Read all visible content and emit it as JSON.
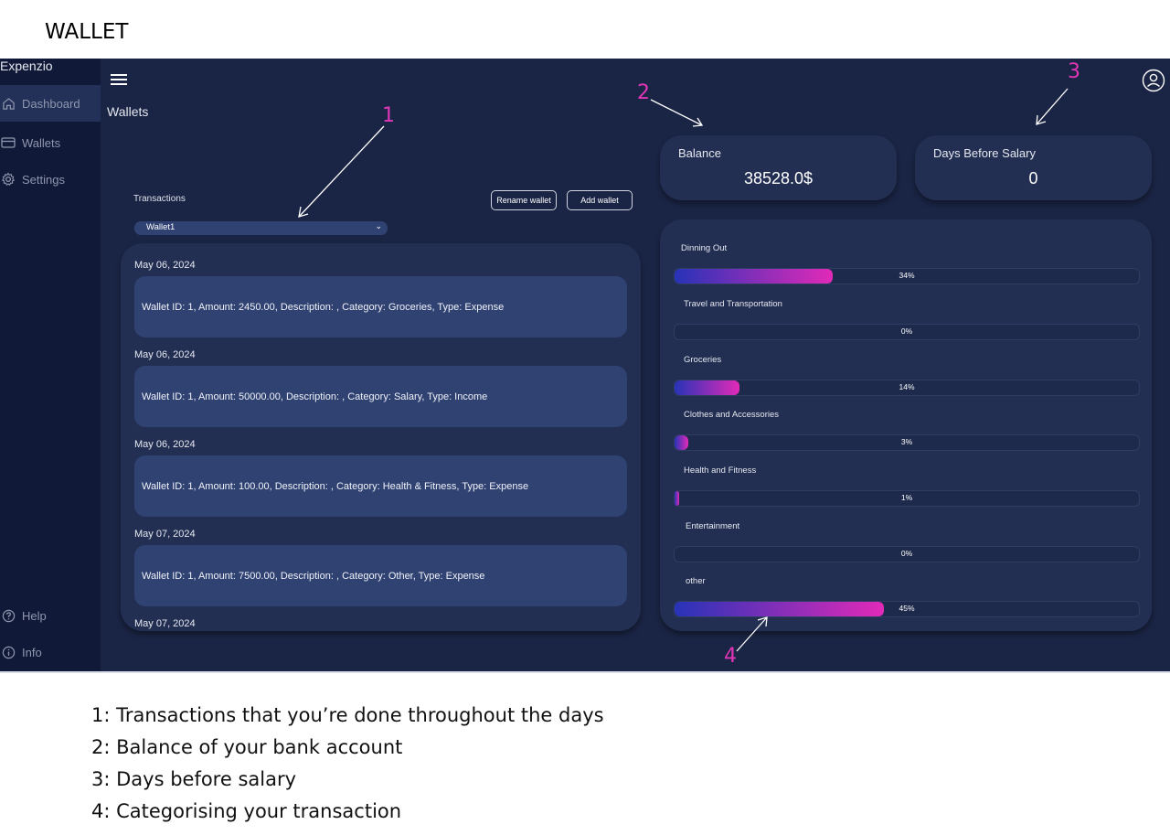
{
  "page": {
    "title": "WALLET"
  },
  "sidebar": {
    "brand": "Expenzio",
    "items": [
      {
        "label": "Dashboard",
        "icon": "home-icon"
      },
      {
        "label": "Wallets",
        "icon": "card-icon"
      },
      {
        "label": "Settings",
        "icon": "gear-icon"
      }
    ],
    "bottom": [
      {
        "label": "Help",
        "icon": "help-icon"
      },
      {
        "label": "Info",
        "icon": "info-icon"
      }
    ]
  },
  "header": {
    "section_title": "Wallets"
  },
  "transactions": {
    "label": "Transactions",
    "rename_label": "Rename wallet",
    "add_label": "Add wallet",
    "selected_wallet": "Wallet1",
    "entries": [
      {
        "date": "May 06, 2024",
        "text": "Wallet ID: 1, Amount: 2450.00, Description: , Category: Groceries, Type: Expense"
      },
      {
        "date": "May 06, 2024",
        "text": "Wallet ID: 1, Amount: 50000.00, Description: , Category: Salary, Type: Income"
      },
      {
        "date": "May 06, 2024",
        "text": "Wallet ID: 1, Amount: 100.00, Description: , Category: Health & Fitness, Type: Expense"
      },
      {
        "date": "May 07, 2024",
        "text": "Wallet ID: 1, Amount: 7500.00, Description: , Category: Other, Type: Expense"
      },
      {
        "date": "May 07, 2024",
        "text": ""
      }
    ]
  },
  "balance": {
    "label": "Balance",
    "value": "38528.0$"
  },
  "salary": {
    "label": "Days Before Salary",
    "value": "0"
  },
  "categories": [
    {
      "name": "Dinning Out",
      "percent_label": "34%",
      "fraction": 0.34
    },
    {
      "name": "Travel and Transportation",
      "percent_label": "0%",
      "fraction": 0
    },
    {
      "name": "Groceries",
      "percent_label": "14%",
      "fraction": 0.14
    },
    {
      "name": "Clothes and Accessories",
      "percent_label": "3%",
      "fraction": 0.03
    },
    {
      "name": "Health  and Fitness",
      "percent_label": "1%",
      "fraction": 0.01
    },
    {
      "name": "Entertainment",
      "percent_label": "0%",
      "fraction": 0
    },
    {
      "name": "other",
      "percent_label": "45%",
      "fraction": 0.45
    }
  ],
  "annotations": {
    "a1": "1",
    "a2": "2",
    "a3": "3",
    "a4": "4"
  },
  "legend": [
    "1: Transactions that you’re done throughout the days",
    "2: Balance of your bank account",
    "3: Days before salary",
    "4: Categorising your transaction"
  ],
  "colors": {
    "accent": "#e236b8",
    "bar_start": "#2733b8",
    "bar_end": "#e22ab8",
    "background": "#1a2444"
  }
}
